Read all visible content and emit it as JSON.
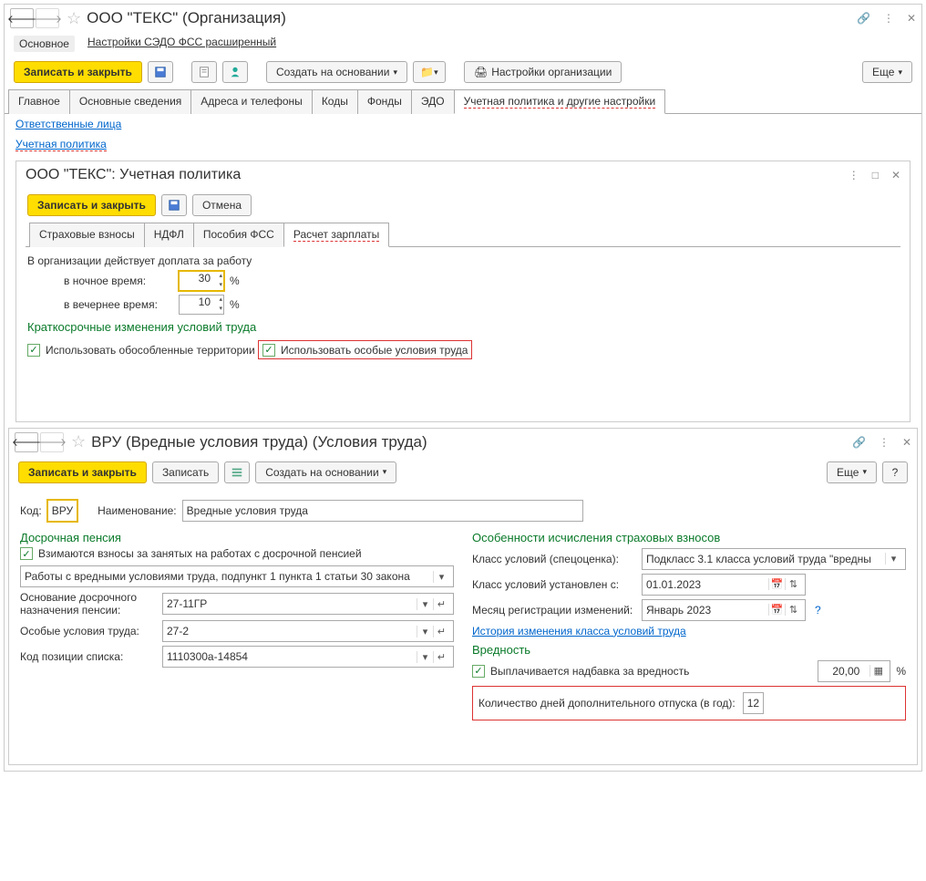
{
  "win1": {
    "title": "ООО \"ТЕКС\" (Организация)",
    "subnav_main": "Основное",
    "subnav_link": "Настройки СЭДО ФСС расширенный",
    "toolbar": {
      "save_close": "Записать и закрыть",
      "create_on_basis": "Создать на основании",
      "org_settings": "Настройки организации",
      "more": "Еще"
    },
    "tabs": {
      "main": "Главное",
      "basic": "Основные сведения",
      "addr": "Адреса и телефоны",
      "codes": "Коды",
      "funds": "Фонды",
      "edo": "ЭДО",
      "policy": "Учетная политика и другие настройки"
    },
    "links": {
      "responsible": "Ответственные лица",
      "policy": "Учетная политика"
    }
  },
  "panel1": {
    "title": "ООО \"ТЕКС\": Учетная политика",
    "toolbar": {
      "save_close": "Записать и закрыть",
      "cancel": "Отмена"
    },
    "tabs": {
      "ins": "Страховые взносы",
      "ndfl": "НДФЛ",
      "fss": "Пособия ФСС",
      "calc": "Расчет зарплаты"
    },
    "body": {
      "text1": "В организации действует доплата за работу",
      "night_lbl": "в ночное время:",
      "night_val": "30",
      "pct": "%",
      "evening_lbl": "в вечернее время:",
      "evening_val": "10",
      "sec1": "Краткосрочные изменения условий труда",
      "chk1": "Использовать обособленные территории",
      "chk2": "Использовать особые условия труда"
    }
  },
  "win2": {
    "title": "ВРУ (Вредные условия труда) (Условия труда)",
    "toolbar": {
      "save_close": "Записать и закрыть",
      "save": "Записать",
      "create": "Создать на основании",
      "more": "Еще"
    },
    "code_lbl": "Код:",
    "code_val": "ВРУ",
    "name_lbl": "Наименование:",
    "name_val": "Вредные условия труда",
    "left": {
      "sec1": "Досрочная пенсия",
      "chk1": "Взимаются взносы за занятых на работах с досрочной пенсией",
      "sel1": "Работы с вредными условиями труда, подпункт 1 пункта 1 статьи 30 закона",
      "f1_lbl": "Основание досрочного назначения пенсии:",
      "f1_val": "27-11ГР",
      "f2_lbl": "Особые условия труда:",
      "f2_val": "27-2",
      "f3_lbl": "Код позиции списка:",
      "f3_val": "1110300а-14854"
    },
    "right": {
      "sec1": "Особенности исчисления страховых взносов",
      "r1_lbl": "Класс условий (спецоценка):",
      "r1_val": "Подкласс 3.1 класса условий труда \"вредны",
      "r2_lbl": "Класс условий установлен с:",
      "r2_val": "01.01.2023",
      "r3_lbl": "Месяц регистрации изменений:",
      "r3_val": "Январь 2023",
      "link": "История изменения класса условий труда",
      "sec2": "Вредность",
      "chk2": "Выплачивается надбавка за вредность",
      "pct_val": "20,00",
      "pct": "%",
      "days_lbl": "Количество дней дополнительного отпуска (в год):",
      "days_val": "12"
    }
  }
}
